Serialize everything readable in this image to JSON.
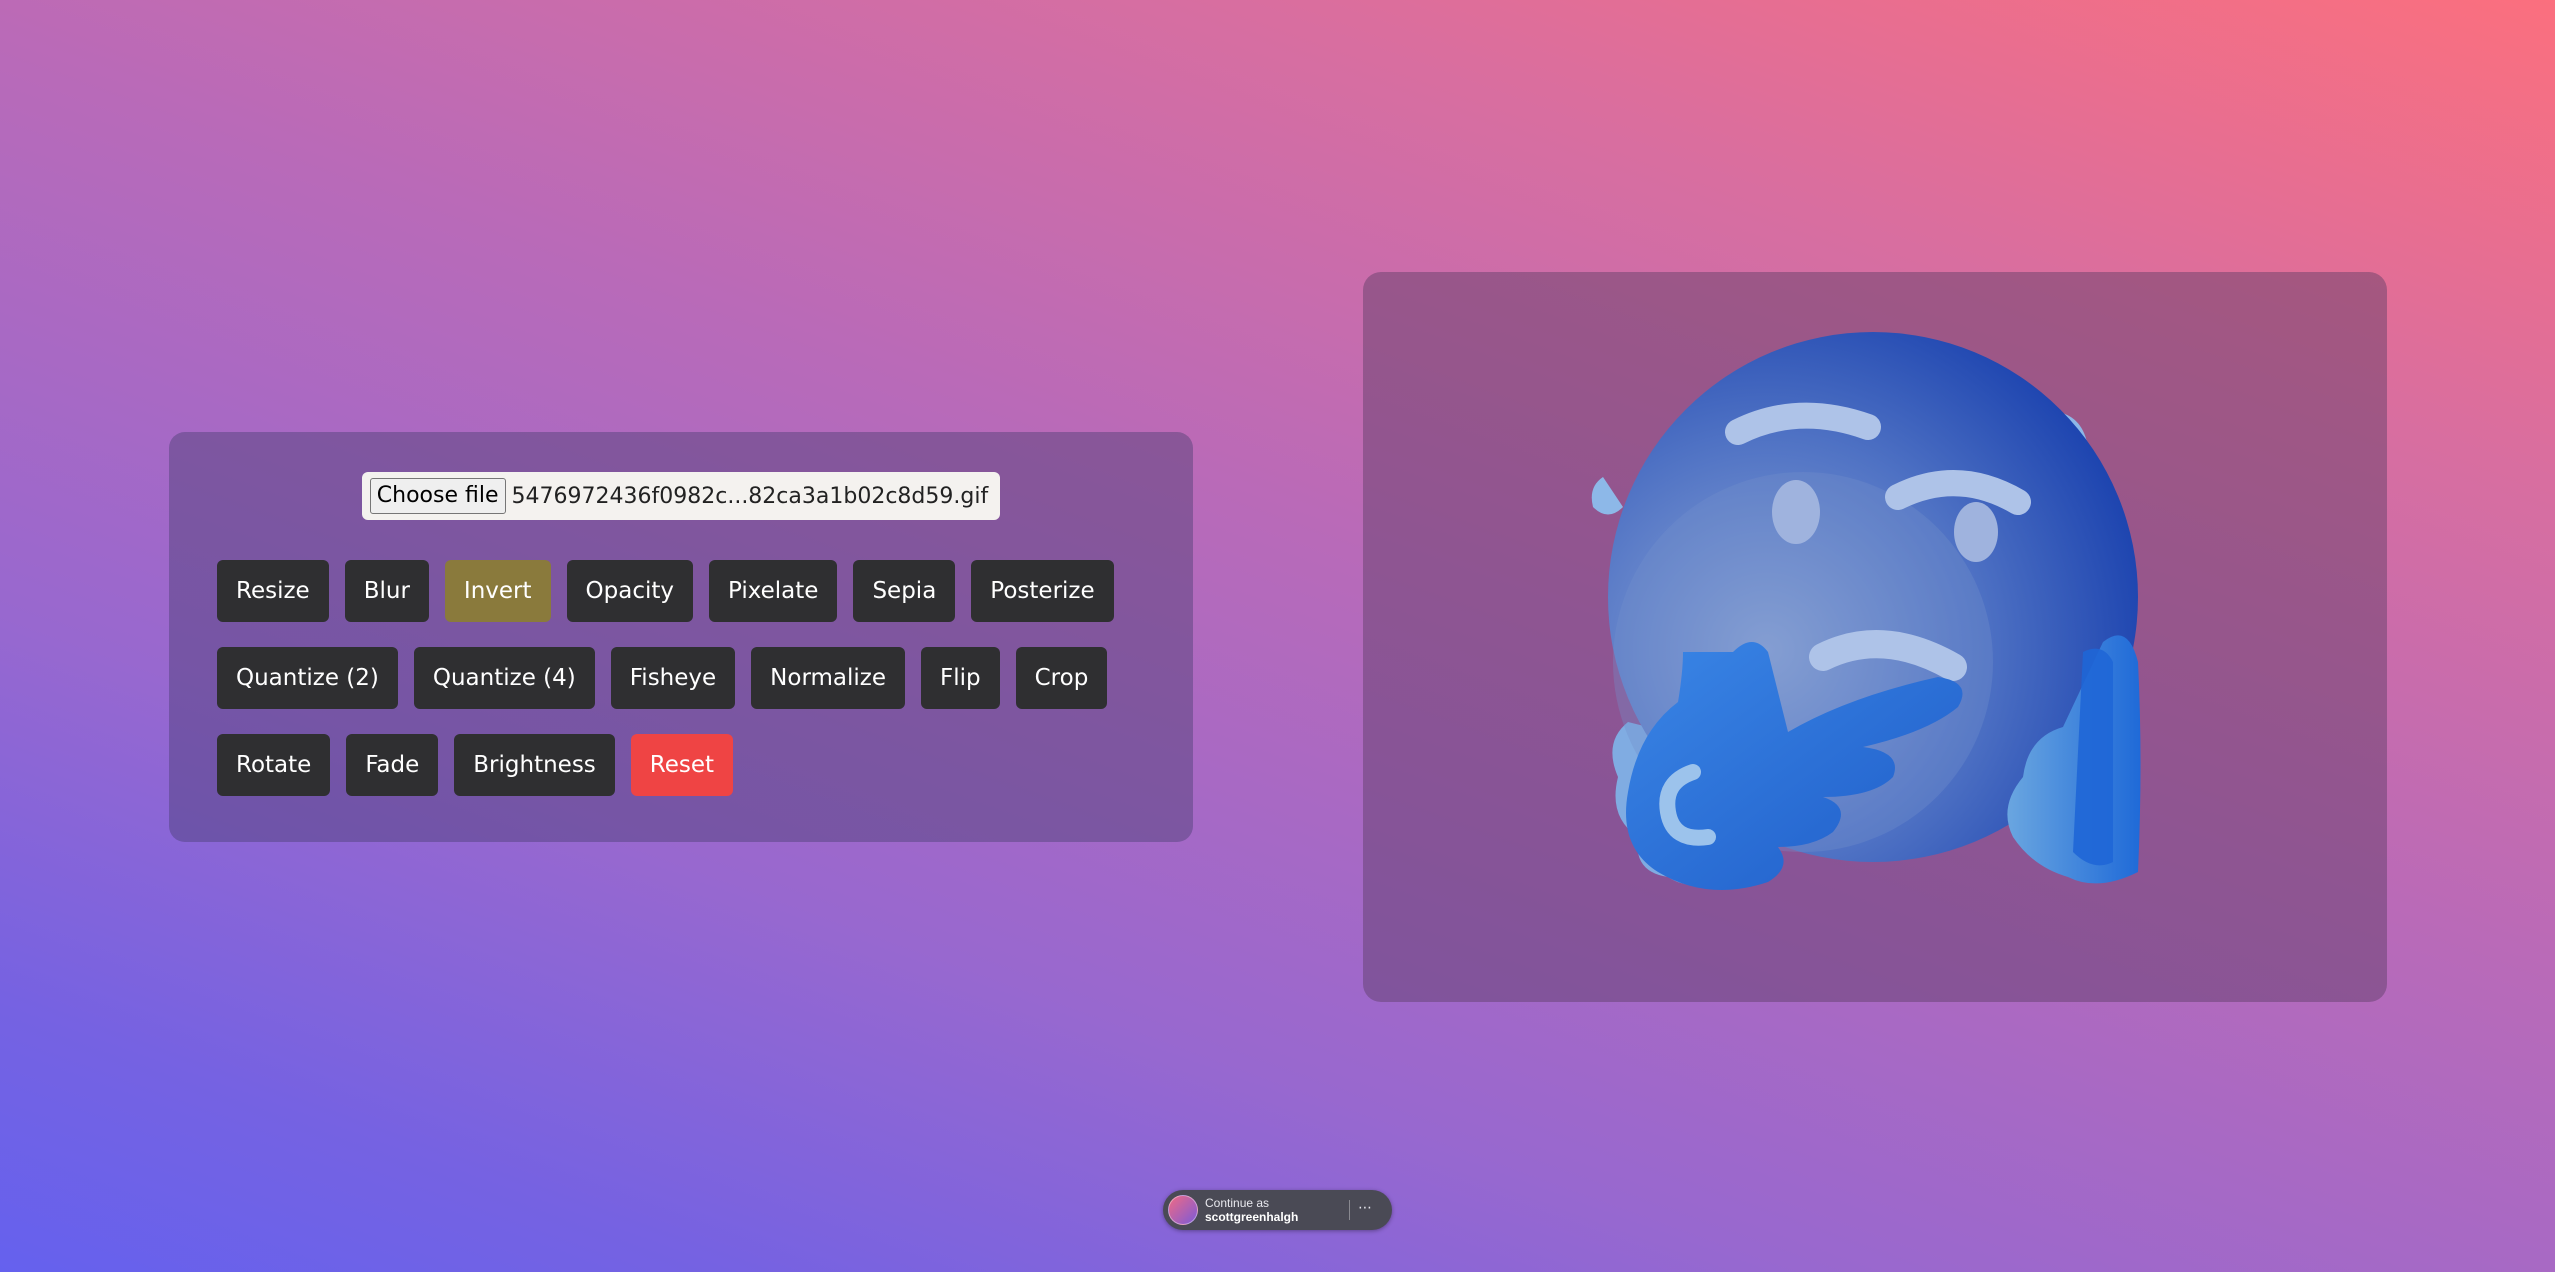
{
  "file_input": {
    "button_label": "Choose file",
    "file_name": "5476972436f0982c...82ca3a1b02c8d59.gif"
  },
  "filters": {
    "rows": [
      [
        "Resize",
        "Blur",
        "Invert",
        "Opacity",
        "Pixelate",
        "Sepia",
        "Posterize"
      ],
      [
        "Quantize (2)",
        "Quantize (4)",
        "Fisheye",
        "Normalize",
        "Flip",
        "Crop"
      ],
      [
        "Rotate",
        "Fade",
        "Brightness",
        "Reset"
      ]
    ],
    "active": "Invert",
    "active_color": "#8a7a3c",
    "reset_color": "#ef4444"
  },
  "preview": {
    "image_icon": "thinking-face-emoji-icon"
  },
  "signin": {
    "line1": "Continue as",
    "line2": "scottgreenhalgh",
    "more_icon": "⋯"
  }
}
